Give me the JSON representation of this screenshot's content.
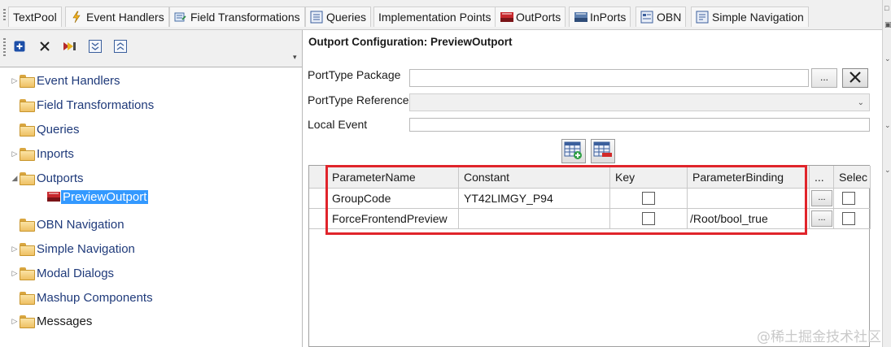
{
  "tabs": [
    {
      "label": "TextPool",
      "icon": "none"
    },
    {
      "label": "Event Handlers",
      "icon": "lightning-icon"
    },
    {
      "label": "Field Transformations",
      "icon": "field-transform-icon"
    },
    {
      "label": "Queries",
      "icon": "queries-icon"
    },
    {
      "label": "Implementation Points",
      "icon": "none"
    },
    {
      "label": "OutPorts",
      "icon": "outports-icon"
    },
    {
      "label": "InPorts",
      "icon": "inports-icon"
    },
    {
      "label": "OBN",
      "icon": "obn-icon"
    },
    {
      "label": "Simple Navigation",
      "icon": "simple-navigation-icon"
    }
  ],
  "left_toolbar": {
    "buttons": [
      "add-icon",
      "delete-icon",
      "sync-icon",
      "expand-all-icon",
      "collapse-all-icon"
    ]
  },
  "tree": {
    "items": [
      {
        "label": "Event Handlers",
        "expandable": true,
        "expanded": false
      },
      {
        "label": "Field Transformations",
        "expandable": false
      },
      {
        "label": "Queries",
        "expandable": false
      },
      {
        "label": "Inports",
        "expandable": true,
        "expanded": false
      },
      {
        "label": "Outports",
        "expandable": true,
        "expanded": true
      },
      {
        "label": "PreviewOutport",
        "child": true,
        "selected": true
      },
      {
        "label": "OBN Navigation",
        "expandable": false
      },
      {
        "label": "Simple Navigation",
        "expandable": true,
        "expanded": false
      },
      {
        "label": "Modal Dialogs",
        "expandable": true,
        "expanded": false
      },
      {
        "label": "Mashup Components",
        "expandable": false
      },
      {
        "label": "Messages",
        "expandable": true,
        "expanded": false
      }
    ]
  },
  "config": {
    "title": "Outport Configuration: PreviewOutport",
    "porttype_package_label": "PortType Package",
    "porttype_package_value": "",
    "browse_label": "...",
    "porttype_reference_label": "PortType Reference",
    "porttype_reference_value": "",
    "local_event_label": "Local Event",
    "local_event_value": ""
  },
  "grid": {
    "headers": [
      "ParameterName",
      "Constant",
      "Key",
      "ParameterBinding",
      "...",
      "Selec"
    ],
    "rows": [
      {
        "name": "GroupCode",
        "constant": "YT42LIMGY_P94",
        "key": false,
        "binding": "",
        "ellipsis": "...",
        "selected": false
      },
      {
        "name": "ForceFrontendPreview",
        "constant": "",
        "key": false,
        "binding": "/Root/bool_true",
        "ellipsis": "...",
        "selected": false
      }
    ]
  },
  "watermark": "@稀土掘金技术社区",
  "colors": {
    "selection": "#3399ff",
    "highlight_box": "#e0242b",
    "tree_text": "#1f3a7a"
  }
}
